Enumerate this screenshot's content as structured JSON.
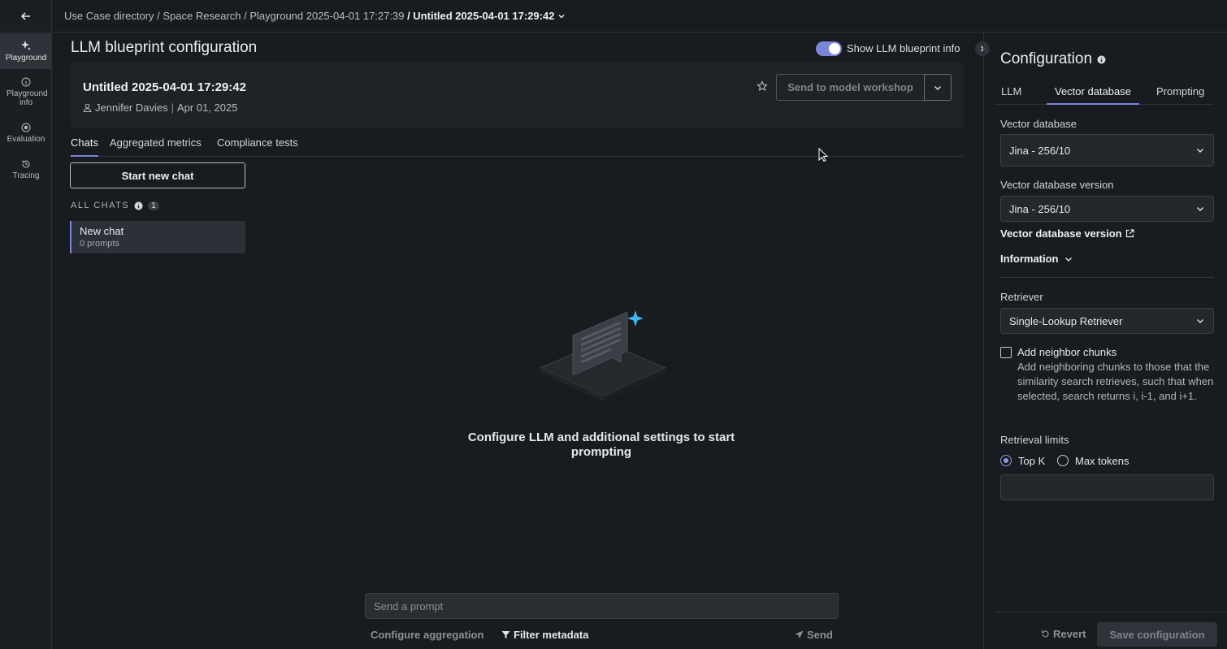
{
  "breadcrumb": {
    "items": [
      "Use Case directory",
      "Space Research",
      "Playground 2025-04-01 17:27:39"
    ],
    "current": "Untitled 2025-04-01 17:29:42",
    "separator": " / "
  },
  "rail": {
    "items": [
      {
        "label": "Playground",
        "icon": "sparkle-icon"
      },
      {
        "label": "Playground info",
        "icon": "info-icon"
      },
      {
        "label": "Evaluation",
        "icon": "target-icon"
      },
      {
        "label": "Tracing",
        "icon": "history-icon"
      }
    ]
  },
  "page": {
    "title": "LLM blueprint configuration",
    "toggle_label": "Show LLM blueprint info"
  },
  "blueprint": {
    "name": "Untitled 2025-04-01 17:29:42",
    "author": "Jennifer Davies",
    "date": "Apr 01, 2025",
    "send_label": "Send to model workshop"
  },
  "tabs": [
    "Chats",
    "Aggregated metrics",
    "Compliance tests"
  ],
  "chats": {
    "new_chat_label": "Start new chat",
    "all_chats_label": "ALL CHATS",
    "count": "1",
    "items": [
      {
        "name": "New chat",
        "prompts": "0 prompts"
      }
    ]
  },
  "empty_state": {
    "message": "Configure LLM and additional settings to start prompting"
  },
  "prompt_bar": {
    "placeholder": "Send a prompt",
    "configure_aggregation": "Configure aggregation",
    "filter_metadata": "Filter metadata",
    "send": "Send"
  },
  "config": {
    "title": "Configuration",
    "tabs": [
      "LLM",
      "Vector database",
      "Prompting"
    ],
    "vector_db_label": "Vector database",
    "vector_db_value": "Jina - 256/10",
    "vector_db_version_label": "Vector database version",
    "vector_db_version_value": "Jina - 256/10",
    "vector_db_version_link": "Vector database version",
    "information_label": "Information",
    "retriever_label": "Retriever",
    "retriever_value": "Single-Lookup Retriever",
    "neighbor_title": "Add neighbor chunks",
    "neighbor_desc": "Add neighboring chunks to those that the similarity search retrieves, such that when selected, search returns i, i-1, and i+1.",
    "retrieval_limits_label": "Retrieval limits",
    "radio_topk": "Top K",
    "radio_maxtokens": "Max tokens",
    "revert_label": "Revert",
    "save_label": "Save configuration"
  },
  "colors": {
    "accent": "#7b86d8",
    "background": "#181c20",
    "sparkle": "#3fb6e8"
  }
}
